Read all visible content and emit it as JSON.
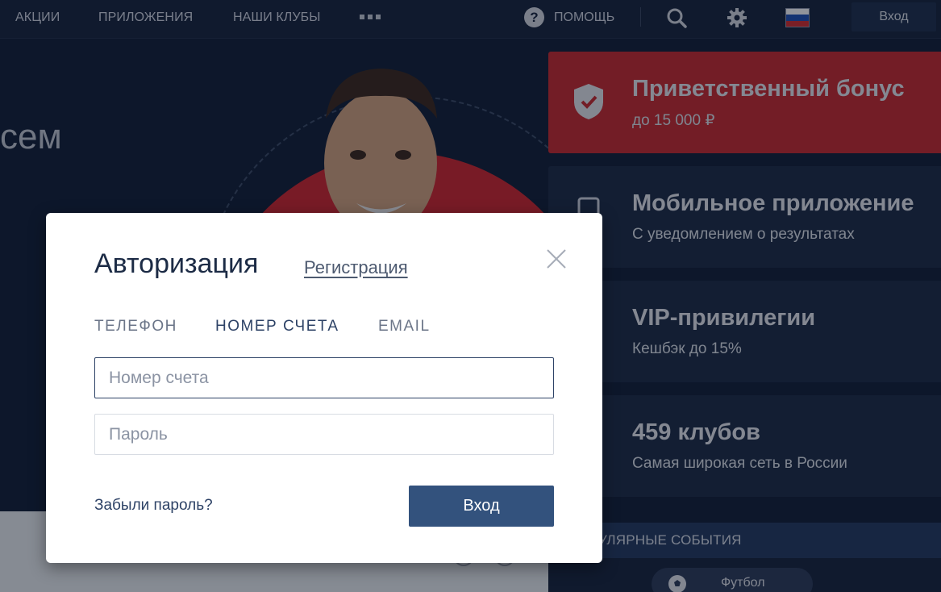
{
  "nav": {
    "items": [
      {
        "label": "АКЦИИ"
      },
      {
        "label": "ПРИЛОЖЕНИЯ"
      },
      {
        "label": "НАШИ КЛУБЫ"
      }
    ],
    "more_icon": "more-dots-icon",
    "help_label": "ПОМОЩЬ",
    "help_icon": "question-circle-icon",
    "search_icon": "search-icon",
    "settings_icon": "gear-icon",
    "language_flag": "russia-flag-icon",
    "login_label": "Вход"
  },
  "hero": {
    "text": "сем"
  },
  "promos": [
    {
      "title": "Приветственный бонус",
      "subtitle": "до 15 000 ₽",
      "icon": "shield-check-icon",
      "color": "#c8272a"
    },
    {
      "title": "Мобильное приложение",
      "subtitle": "С уведомлением о результатах",
      "icon": "phone-icon",
      "color": "#1a2842"
    },
    {
      "title": "VIP-привилегии",
      "subtitle": "Кешбэк до 15%",
      "icon": "crown-icon",
      "color": "#1a2842"
    },
    {
      "title": "459 клубов",
      "subtitle": "Самая широкая сеть в России",
      "icon": "location-icon",
      "color": "#1a2842"
    }
  ],
  "popular": {
    "label": "УЛЯРНЫЕ СОБЫТИЯ",
    "sport_selected": "Футбол"
  },
  "modal": {
    "title": "Авторизация",
    "register_link": "Регистрация",
    "tabs": [
      {
        "label": "ТЕЛЕФОН",
        "active": false
      },
      {
        "label": "НОМЕР СЧЕТА",
        "active": true
      },
      {
        "label": "EMAIL",
        "active": false
      }
    ],
    "account_field": {
      "value": "",
      "placeholder": "Номер счета"
    },
    "password_field": {
      "value": "",
      "placeholder": "Пароль"
    },
    "forgot_link": "Забыли пароль?",
    "submit_label": "Вход"
  },
  "colors": {
    "accent_red": "#c8272a",
    "primary_blue": "#33527d",
    "nav_bg": "#15213a"
  }
}
